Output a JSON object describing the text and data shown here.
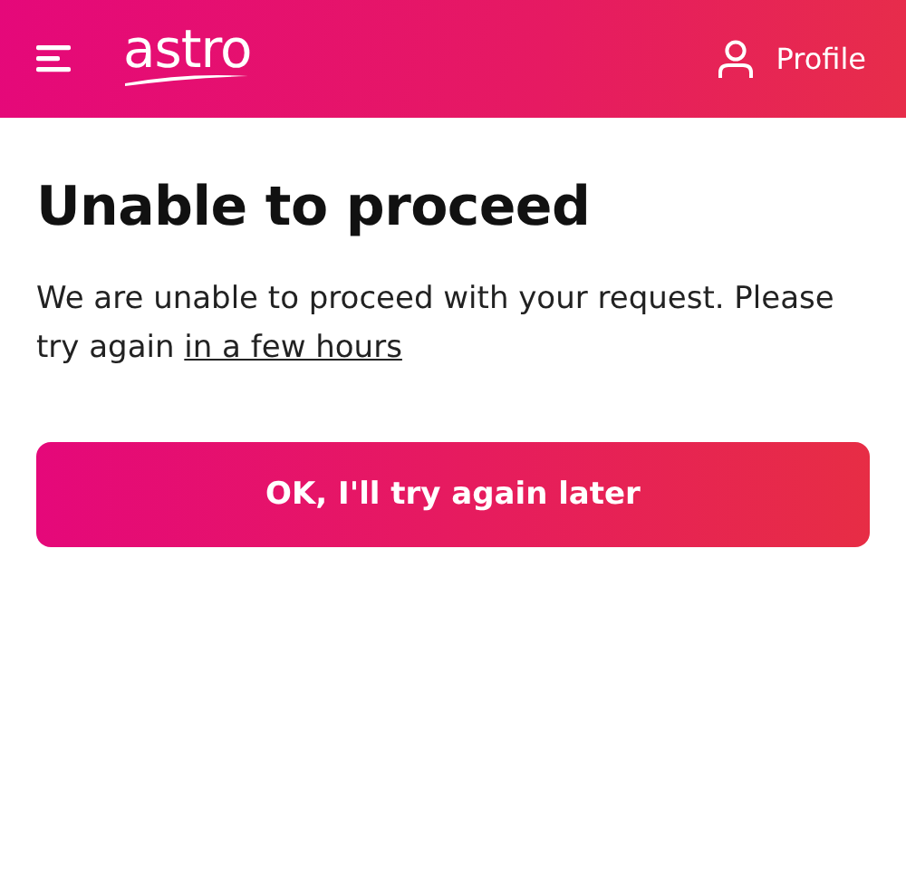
{
  "header": {
    "logo": "astro",
    "profile": "Profile"
  },
  "title": "Unable to proceed",
  "message": {
    "text": "We are unable to proceed with your request. Please try again",
    "link": "in a few hours"
  },
  "button": "OK, I'll try again later"
}
